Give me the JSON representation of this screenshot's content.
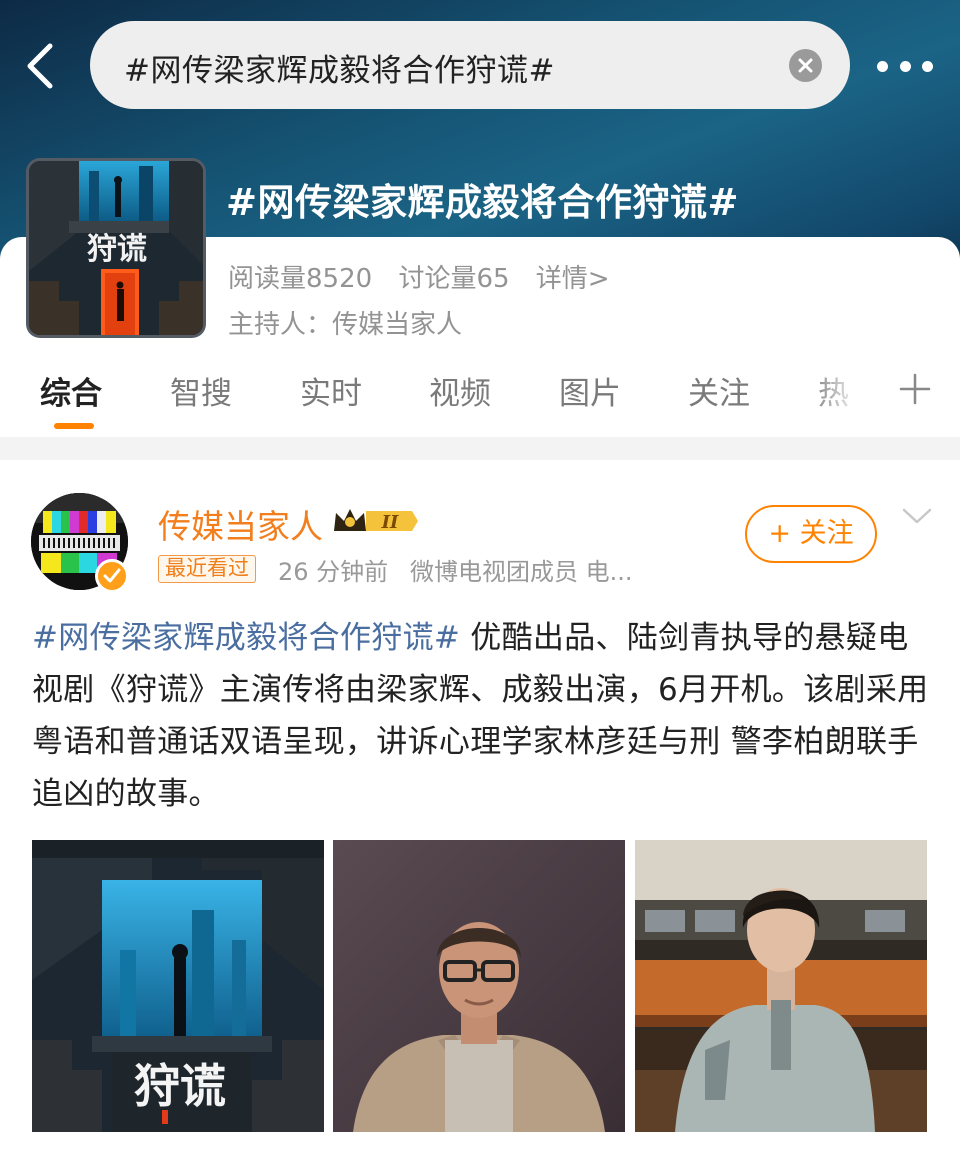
{
  "search": {
    "query": "#网传梁家辉成毅将合作狩谎#"
  },
  "topic": {
    "title": "#网传梁家辉成毅将合作狩谎#",
    "cover_title": "狩谎",
    "reads": "阅读量8520",
    "discussions": "讨论量65",
    "details": "详情>",
    "host": "主持人：传媒当家人"
  },
  "tabs": [
    "综合",
    "智搜",
    "实时",
    "视频",
    "图片",
    "关注",
    "热"
  ],
  "post": {
    "author": "传媒当家人",
    "level": "II",
    "recent_tag": "最近看过",
    "time": "26 分钟前",
    "source": "微博电视团成员 电...",
    "follow_label": "+ 关注",
    "hashtag": "#网传梁家辉成毅将合作狩谎#",
    "body": " 优酷出品、陆剑青执导的悬疑电视剧《狩谎》主演传将由梁家辉、成毅出演，6月开机。该剧采用粤语和普通话双语呈现，讲诉心理学家林彦廷与刑 警李柏朗联手追凶的故事。",
    "image_1_title": "狩谎"
  },
  "colors": {
    "accent": "#ff8200",
    "author_name": "#f27e1d",
    "hashtag": "#4a6ea0",
    "header_bg": "#155272"
  },
  "icons": {
    "back": "chevron-left-icon",
    "clear": "clear-icon",
    "more": "more-horizontal-icon",
    "plus": "plus-icon",
    "dropdown": "chevron-down-icon",
    "crown": "crown-icon",
    "vip": "verified-badge-icon"
  }
}
